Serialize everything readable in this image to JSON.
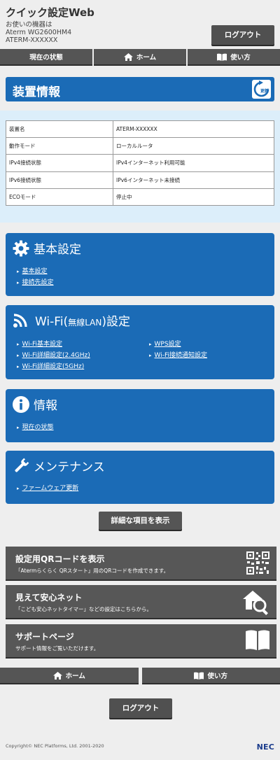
{
  "header": {
    "title": "クイック設定Web",
    "device_label": "お使いの機器は",
    "model": "Aterm WG2600HM4",
    "device_name": "ATERM-XXXXXX",
    "logout": "ログアウト"
  },
  "nav": {
    "status": "現在の状態",
    "home": "ホーム",
    "help": "使い方"
  },
  "device_info": {
    "title": "装置情報",
    "refresh": "更新",
    "rows": [
      {
        "key": "装置名",
        "value": "ATERM-XXXXXX"
      },
      {
        "key": "動作モード",
        "value": "ローカルルータ"
      },
      {
        "key": "IPv4接続状態",
        "value": "IPv4インターネット利用可能"
      },
      {
        "key": "IPv6接続状態",
        "value": "IPv6インターネット未接続"
      },
      {
        "key": "ECOモード",
        "value": "停止中"
      }
    ]
  },
  "panels": {
    "basic": {
      "title": "基本設定",
      "links": [
        "基本設定",
        "接続先設定"
      ]
    },
    "wifi": {
      "title": "Wi-Fi(無線LAN)設定",
      "title_main": "Wi-Fi(",
      "title_small": "無線LAN",
      "title_end": ")設定",
      "links": [
        "Wi-Fi基本設定",
        "Wi-Fi詳細設定(2.4GHz)",
        "Wi-Fi詳細設定(5GHz)",
        "WPS設定",
        "Wi-Fi接続通知設定"
      ]
    },
    "info": {
      "title": "情報",
      "links": [
        "現在の状態"
      ]
    },
    "maint": {
      "title": "メンテナンス",
      "links": [
        "ファームウェア更新"
      ]
    }
  },
  "detail_button": "詳細な項目を表示",
  "blocks": [
    {
      "title": "設定用QRコードを表示",
      "desc": "「Atermらくらく QRスタート」用のQRコードを作成できます。"
    },
    {
      "title": "見えて安心ネット",
      "desc": "「こども安心ネットタイマー」などの設定はこちらから。"
    },
    {
      "title": "サポートページ",
      "desc": "サポート情報をご覧いただけます。"
    }
  ],
  "bottom_nav": {
    "home": "ホーム",
    "help": "使い方"
  },
  "logout_bottom": "ログアウト",
  "footer": {
    "copyright": "Copyright© NEC Platforms, Ltd. 2001-2020",
    "logo": "NEC"
  },
  "colors": {
    "accent_blue": "#1b6bb6",
    "button_gray": "#555555"
  }
}
